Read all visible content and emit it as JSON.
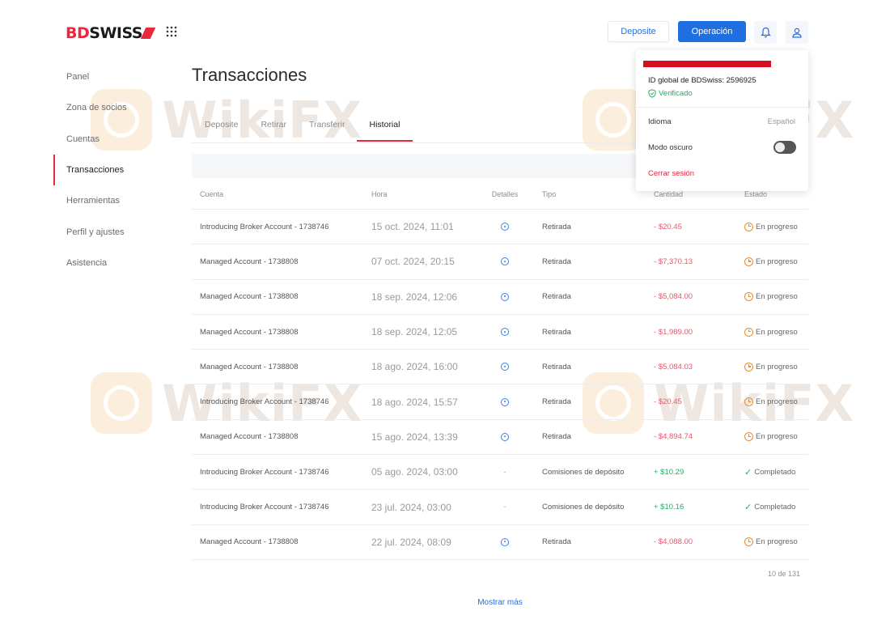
{
  "header": {
    "logo_bd": "BD",
    "logo_swiss": "SWISS",
    "deposit_button": "Deposite",
    "operation_button": "Operación"
  },
  "sidebar": {
    "items": [
      {
        "label": "Panel"
      },
      {
        "label": "Zona de socios"
      },
      {
        "label": "Cuentas"
      },
      {
        "label": "Transacciones",
        "active": true
      },
      {
        "label": "Herramientas"
      },
      {
        "label": "Perfil y ajustes"
      },
      {
        "label": "Asistencia"
      }
    ]
  },
  "main": {
    "title": "Transacciones",
    "tabs": [
      "Deposite",
      "Retirar",
      "Transferir",
      "Historial"
    ],
    "active_tab": "Historial",
    "columns": [
      "Cuenta",
      "Hora",
      "Detalles",
      "Tipo",
      "Cantidad",
      "Estado"
    ],
    "rows": [
      {
        "account": "Introducing Broker Account - 1738746",
        "time": "15 oct. 2024, 11:01",
        "details": "info",
        "type": "Retirada",
        "amount": "- $20.45",
        "status": "En progreso"
      },
      {
        "account": "Managed Account - 1738808",
        "time": "07 oct. 2024, 20:15",
        "details": "info",
        "type": "Retirada",
        "amount": "- $7,370.13",
        "status": "En progreso"
      },
      {
        "account": "Managed Account - 1738808",
        "time": "18 sep. 2024, 12:06",
        "details": "info",
        "type": "Retirada",
        "amount": "- $5,084.00",
        "status": "En progreso"
      },
      {
        "account": "Managed Account - 1738808",
        "time": "18 sep. 2024, 12:05",
        "details": "info",
        "type": "Retirada",
        "amount": "- $1,989.00",
        "status": "En progreso"
      },
      {
        "account": "Managed Account - 1738808",
        "time": "18 ago. 2024, 16:00",
        "details": "info",
        "type": "Retirada",
        "amount": "- $5,084.03",
        "status": "En progreso"
      },
      {
        "account": "Introducing Broker Account - 1738746",
        "time": "18 ago. 2024, 15:57",
        "details": "info",
        "type": "Retirada",
        "amount": "- $20.45",
        "status": "En progreso"
      },
      {
        "account": "Managed Account - 1738808",
        "time": "15 ago. 2024, 13:39",
        "details": "info",
        "type": "Retirada",
        "amount": "- $4,894.74",
        "status": "En progreso"
      },
      {
        "account": "Introducing Broker Account - 1738746",
        "time": "05 ago. 2024, 03:00",
        "details": "-",
        "type": "Comisiones de depósito",
        "amount": "+ $10.29",
        "status": "Completado"
      },
      {
        "account": "Introducing Broker Account - 1738746",
        "time": "23 jul. 2024, 03:00",
        "details": "-",
        "type": "Comisiones de depósito",
        "amount": "+ $10.16",
        "status": "Completado"
      },
      {
        "account": "Managed Account - 1738808",
        "time": "22 jul. 2024, 08:09",
        "details": "info",
        "type": "Retirada",
        "amount": "- $4,088.00",
        "status": "En progreso"
      }
    ],
    "pagination": "10 de 131",
    "show_more": "Mostrar más"
  },
  "dropdown": {
    "global_id": "ID global de BDSwiss: 2596925",
    "verified": "Verificado",
    "language_label": "Idioma",
    "language_value": "Español",
    "dark_mode_label": "Modo oscuro",
    "dark_mode_on": false,
    "logout": "Cerrar sesión"
  },
  "watermark": "WikiFX",
  "colors": {
    "brand_red": "#e8283d",
    "primary_blue": "#1f6fe0",
    "negative": "#e8576a",
    "positive": "#1fae67",
    "pending": "#f08a2b"
  }
}
